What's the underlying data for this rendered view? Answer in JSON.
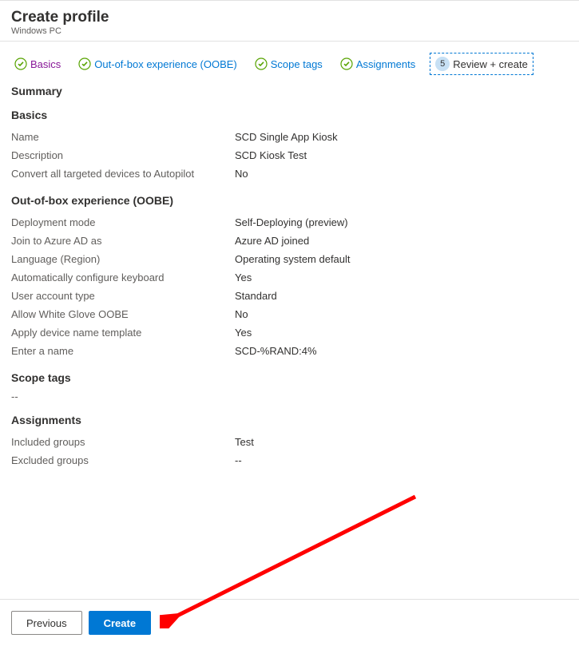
{
  "header": {
    "title": "Create profile",
    "subtitle": "Windows PC"
  },
  "tabs": {
    "basics": "Basics",
    "oobe": "Out-of-box experience (OOBE)",
    "scope": "Scope tags",
    "assignments": "Assignments",
    "review_step": "5",
    "review": "Review + create"
  },
  "sections": {
    "summary": "Summary",
    "basics": "Basics",
    "oobe": "Out-of-box experience (OOBE)",
    "scope": "Scope tags",
    "assignments": "Assignments"
  },
  "basics": {
    "name_label": "Name",
    "name_value": "SCD Single App Kiosk",
    "desc_label": "Description",
    "desc_value": "SCD Kiosk Test",
    "convert_label": "Convert all targeted devices to Autopilot",
    "convert_value": "No"
  },
  "oobe": {
    "deploy_label": "Deployment mode",
    "deploy_value": "Self-Deploying (preview)",
    "join_label": "Join to Azure AD as",
    "join_value": "Azure AD joined",
    "lang_label": "Language (Region)",
    "lang_value": "Operating system default",
    "keyboard_label": "Automatically configure keyboard",
    "keyboard_value": "Yes",
    "usertype_label": "User account type",
    "usertype_value": "Standard",
    "whiteglove_label": "Allow White Glove OOBE",
    "whiteglove_value": "No",
    "template_label": "Apply device name template",
    "template_value": "Yes",
    "entername_label": "Enter a name",
    "entername_value": "SCD-%RAND:4%"
  },
  "scope": {
    "dash": "--"
  },
  "assignments": {
    "included_label": "Included groups",
    "included_value": "Test",
    "excluded_label": "Excluded groups",
    "excluded_value": "--"
  },
  "footer": {
    "previous": "Previous",
    "create": "Create"
  }
}
